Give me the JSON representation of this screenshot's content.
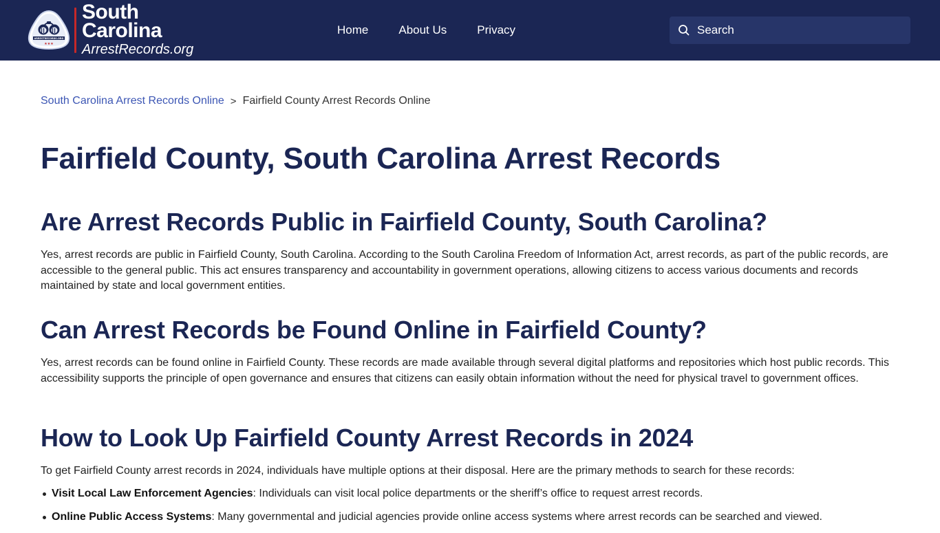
{
  "header": {
    "logo": {
      "line1": "South",
      "line2": "Carolina",
      "line3": "ArrestRecords.org",
      "badge_text": "ARRESTRECORDS.ORG"
    },
    "nav": [
      {
        "label": "Home"
      },
      {
        "label": "About Us"
      },
      {
        "label": "Privacy"
      }
    ],
    "search": {
      "placeholder": "Search",
      "value": ""
    }
  },
  "breadcrumb": {
    "parent": "South Carolina Arrest Records Online",
    "separator": ">",
    "current": "Fairfield County Arrest Records Online"
  },
  "page": {
    "title": "Fairfield County, South Carolina Arrest Records",
    "sections": [
      {
        "heading": "Are Arrest Records Public in Fairfield County, South Carolina?",
        "body": "Yes, arrest records are public in Fairfield County, South Carolina. According to the South Carolina Freedom of Information Act, arrest records, as part of the public records, are accessible to the general public. This act ensures transparency and accountability in government operations, allowing citizens to access various documents and records maintained by state and local government entities."
      },
      {
        "heading": "Can Arrest Records be Found Online in Fairfield County?",
        "body": "Yes, arrest records can be found online in Fairfield County. These records are made available through several digital platforms and repositories which host public records. This accessibility supports the principle of open governance and ensures that citizens can easily obtain information without the need for physical travel to government offices."
      },
      {
        "heading": "How to Look Up Fairfield County Arrest Records in 2024",
        "body": "To get Fairfield County arrest records in 2024, individuals have multiple options at their disposal. Here are the primary methods to search for these records:",
        "list": [
          {
            "term": "Visit Local Law Enforcement Agencies",
            "text": ": Individuals can visit local police departments or the sheriff’s office to request arrest records."
          },
          {
            "term": "Online Public Access Systems",
            "text": ": Many governmental and judicial agencies provide online access systems where arrest records can be searched and viewed."
          }
        ]
      }
    ]
  },
  "colors": {
    "header_bg": "#1b2654",
    "search_bg": "#273569",
    "heading": "#1b2654",
    "link": "#3c56b4",
    "logo_accent": "#c62828"
  }
}
